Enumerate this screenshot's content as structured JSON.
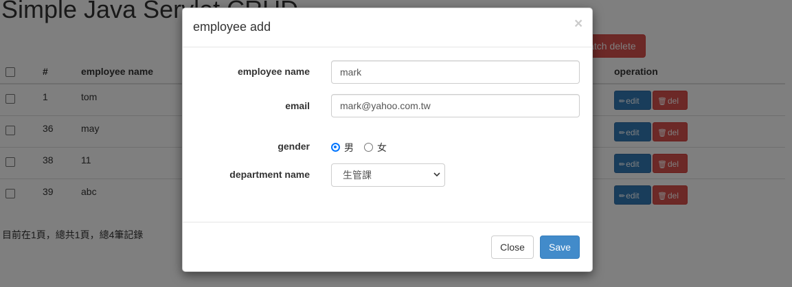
{
  "page": {
    "title": "Simple Java Servlet CRUD",
    "batch_delete_label": "batch delete",
    "pager_text": "目前在1頁，總共1頁，總4筆記錄"
  },
  "table": {
    "headers": {
      "num": "#",
      "name": "employee name",
      "operation": "operation"
    },
    "edit_label": "edit",
    "del_label": "del",
    "rows": [
      {
        "id": "1",
        "name": "tom"
      },
      {
        "id": "36",
        "name": "may"
      },
      {
        "id": "38",
        "name": "11"
      },
      {
        "id": "39",
        "name": "abc"
      }
    ]
  },
  "modal": {
    "title": "employee add",
    "close_icon": "×",
    "fields": {
      "name_label": "employee name",
      "name_value": "mark",
      "email_label": "email",
      "email_value": "mark@yahoo.com.tw",
      "gender_label": "gender",
      "gender_male": "男",
      "gender_female": "女",
      "gender_selected": "男",
      "department_label": "department name",
      "department_value": "生管課"
    },
    "close_button": "Close",
    "save_button": "Save"
  },
  "colors": {
    "primary": "#428bca",
    "danger": "#d9534f",
    "edit": "#337ab7"
  }
}
